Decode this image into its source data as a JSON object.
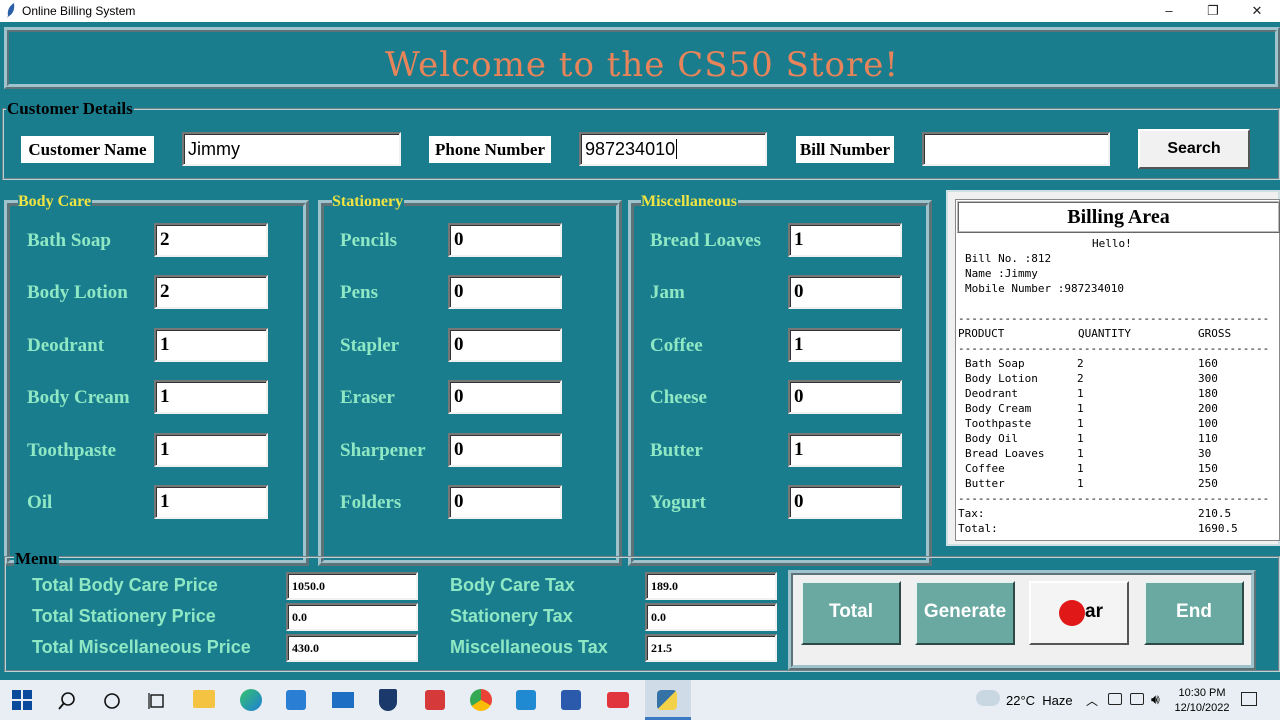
{
  "window": {
    "title": "Online Billing System",
    "minimize": "–",
    "maximize": "❐",
    "close": "✕"
  },
  "header": {
    "title": "Welcome to the CS50 Store!"
  },
  "customer": {
    "legend": "Customer Details",
    "name_label": "Customer Name",
    "name_value": "Jimmy",
    "phone_label": "Phone Number",
    "phone_value": "987234010",
    "bill_label": "Bill Number",
    "bill_value": "",
    "search_label": "Search"
  },
  "body_care": {
    "title": "Body Care",
    "items": [
      {
        "label": "Bath Soap",
        "value": "2"
      },
      {
        "label": "Body Lotion",
        "value": "2"
      },
      {
        "label": "Deodrant",
        "value": "1"
      },
      {
        "label": "Body Cream",
        "value": "1"
      },
      {
        "label": "Toothpaste",
        "value": "1"
      },
      {
        "label": "Oil",
        "value": "1"
      }
    ]
  },
  "stationery": {
    "title": "Stationery",
    "items": [
      {
        "label": "Pencils",
        "value": "0"
      },
      {
        "label": "Pens",
        "value": "0"
      },
      {
        "label": "Stapler",
        "value": "0"
      },
      {
        "label": "Eraser",
        "value": "0"
      },
      {
        "label": "Sharpener",
        "value": "0"
      },
      {
        "label": "Folders",
        "value": "0"
      }
    ]
  },
  "misc": {
    "title": "Miscellaneous",
    "items": [
      {
        "label": "Bread Loaves",
        "value": "1"
      },
      {
        "label": "Jam",
        "value": "0"
      },
      {
        "label": "Coffee",
        "value": "1"
      },
      {
        "label": "Cheese",
        "value": "0"
      },
      {
        "label": "Butter",
        "value": "1"
      },
      {
        "label": "Yogurt",
        "value": "0"
      }
    ]
  },
  "bill": {
    "title": "Billing Area",
    "hello": "Hello!",
    "bill_no": "Bill No. :812",
    "name": "Name :Jimmy",
    "mobile": "Mobile Number :987234010",
    "divider": "-----------------------------------------------",
    "headers": [
      "PRODUCT",
      "QUANTITY",
      "GROSS"
    ],
    "rows": [
      [
        "Bath Soap",
        "2",
        "160"
      ],
      [
        "Body Lotion",
        "2",
        "300"
      ],
      [
        "Deodrant",
        "1",
        "180"
      ],
      [
        "Body Cream",
        "1",
        "200"
      ],
      [
        "Toothpaste",
        "1",
        "100"
      ],
      [
        "Body Oil",
        "1",
        "110"
      ],
      [
        "Bread Loaves",
        "1",
        "30"
      ],
      [
        "Coffee",
        "1",
        "150"
      ],
      [
        "Butter",
        "1",
        "250"
      ]
    ],
    "tax_label": "Tax:",
    "tax_value": "210.5",
    "total_label": "Total:",
    "total_value": "1690.5"
  },
  "menu": {
    "legend": "Menu",
    "body_care_price_label": "Total Body Care Price",
    "body_care_price": "1050.0",
    "stationery_price_label": "Total Stationery Price",
    "stationery_price": "0.0",
    "misc_price_label": "Total Miscellaneous Price",
    "misc_price": "430.0",
    "body_care_tax_label": "Body Care Tax",
    "body_care_tax": "189.0",
    "stationery_tax_label": "Stationery Tax",
    "stationery_tax": "0.0",
    "misc_tax_label": "Miscellaneous Tax",
    "misc_tax": "21.5"
  },
  "actions": {
    "total": "Total",
    "generate": "Generate",
    "clear": "ar",
    "end": "End"
  },
  "taskbar": {
    "weather": "22°C  Haze",
    "time": "10:30 PM",
    "date": "12/10/2022"
  },
  "colors": {
    "bg": "#1a7d8e",
    "title": "#e8845a",
    "category": "#f0e442",
    "label": "#8fe8c4",
    "button": "#6aa9a2"
  }
}
